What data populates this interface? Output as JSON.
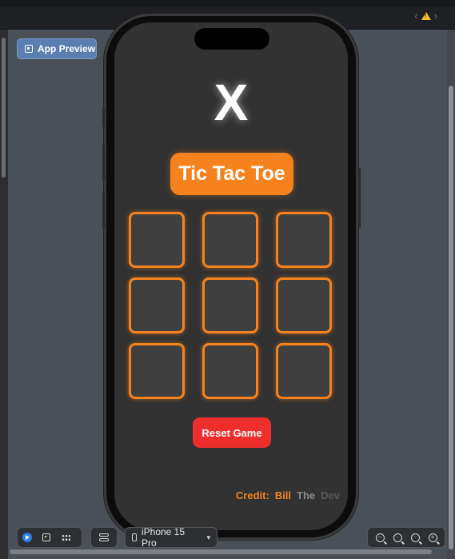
{
  "toolbar": {
    "app_preview_label": "App Preview",
    "warning_icon": "warning-icon"
  },
  "game": {
    "winner_mark": "X",
    "title": "Tic Tac Toe",
    "cells": [
      "",
      "",
      "",
      "",
      "",
      "",
      "",
      "",
      ""
    ],
    "reset_label": "Reset Game",
    "credit_label": "Credit:",
    "credit_words": [
      "Bill",
      "The",
      "Dev"
    ],
    "accent_color": "#f6821e",
    "reset_color": "#ee2d2d"
  },
  "bottom_toolbar": {
    "device_label": "iPhone 15 Pro",
    "zoom_icons": [
      "zoom-out-icon",
      "zoom-fit-icon",
      "zoom-actual-icon",
      "zoom-in-icon"
    ]
  }
}
